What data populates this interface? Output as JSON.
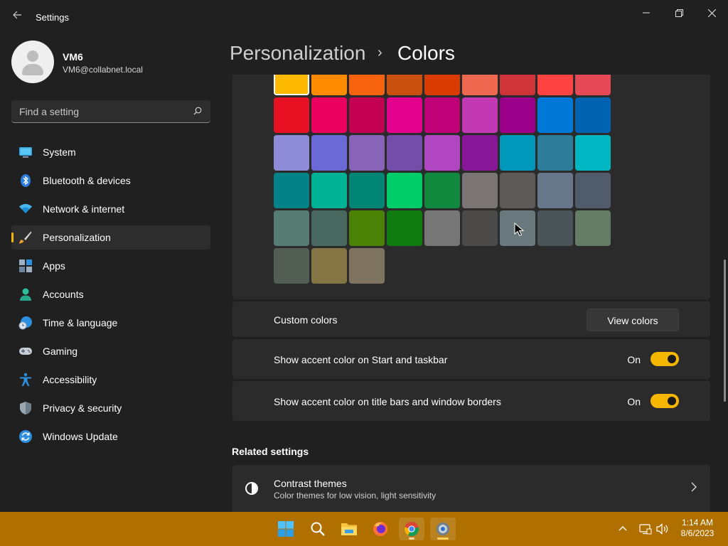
{
  "window": {
    "title": "Settings",
    "back_icon": "arrow-left-icon",
    "controls": [
      "minimize-icon",
      "restore-icon",
      "close-icon"
    ]
  },
  "profile": {
    "name": "VM6",
    "email": "VM6@collabnet.local"
  },
  "search": {
    "placeholder": "Find a setting"
  },
  "sidebar": {
    "items": [
      {
        "label": "System",
        "icon": "monitor-icon",
        "active": false
      },
      {
        "label": "Bluetooth & devices",
        "icon": "bluetooth-icon",
        "active": false
      },
      {
        "label": "Network & internet",
        "icon": "wifi-icon",
        "active": false
      },
      {
        "label": "Personalization",
        "icon": "brush-icon",
        "active": true
      },
      {
        "label": "Apps",
        "icon": "apps-icon",
        "active": false
      },
      {
        "label": "Accounts",
        "icon": "person-icon",
        "active": false
      },
      {
        "label": "Time & language",
        "icon": "globe-clock-icon",
        "active": false
      },
      {
        "label": "Gaming",
        "icon": "gamepad-icon",
        "active": false
      },
      {
        "label": "Accessibility",
        "icon": "accessibility-icon",
        "active": false
      },
      {
        "label": "Privacy & security",
        "icon": "shield-icon",
        "active": false
      },
      {
        "label": "Windows Update",
        "icon": "update-icon",
        "active": false
      }
    ]
  },
  "header": {
    "parent": "Personalization",
    "separator": "›",
    "current": "Colors"
  },
  "accent_colors": {
    "selected_index": 0,
    "swatches": [
      "#ffb900",
      "#ff8c00",
      "#f7630c",
      "#ca5010",
      "#da3b01",
      "#ef6950",
      "#d13438",
      "#ff4343",
      "#e74856",
      "#e81123",
      "#ea005e",
      "#c30052",
      "#e3008c",
      "#bf0077",
      "#c239b3",
      "#9a0089",
      "#0078d7",
      "#0063b1",
      "#8e8cd8",
      "#6b69d6",
      "#8764b8",
      "#744da9",
      "#b146c2",
      "#881798",
      "#0099bc",
      "#2d7d9a",
      "#00b7c3",
      "#038387",
      "#00b294",
      "#018574",
      "#00cc6a",
      "#10893e",
      "#7a7574",
      "#5d5a58",
      "#68768a",
      "#515c6b",
      "#567c73",
      "#486860",
      "#498205",
      "#107c10",
      "#767676",
      "#4c4a48",
      "#69797e",
      "#4a5459",
      "#647c64",
      "#525e54",
      "#847545",
      "#7e735f"
    ]
  },
  "custom_colors": {
    "label": "Custom colors",
    "button": "View colors"
  },
  "toggles": [
    {
      "label": "Show accent color on Start and taskbar",
      "state": "On",
      "value": true
    },
    {
      "label": "Show accent color on title bars and window borders",
      "state": "On",
      "value": true
    }
  ],
  "related": {
    "heading": "Related settings",
    "items": [
      {
        "title": "Contrast themes",
        "subtitle": "Color themes for low vision, light sensitivity",
        "icon": "contrast-icon"
      }
    ]
  },
  "taskbar": {
    "color": "#b07000",
    "apps": [
      {
        "name": "start-icon"
      },
      {
        "name": "search-icon"
      },
      {
        "name": "file-explorer-icon"
      },
      {
        "name": "firefox-icon"
      },
      {
        "name": "chrome-icon",
        "active": true
      },
      {
        "name": "settings-icon",
        "active": true
      }
    ],
    "tray": [
      "chevron-up-icon",
      "network-icon",
      "volume-icon"
    ],
    "time": "1:14 AM",
    "date": "8/6/2023"
  }
}
